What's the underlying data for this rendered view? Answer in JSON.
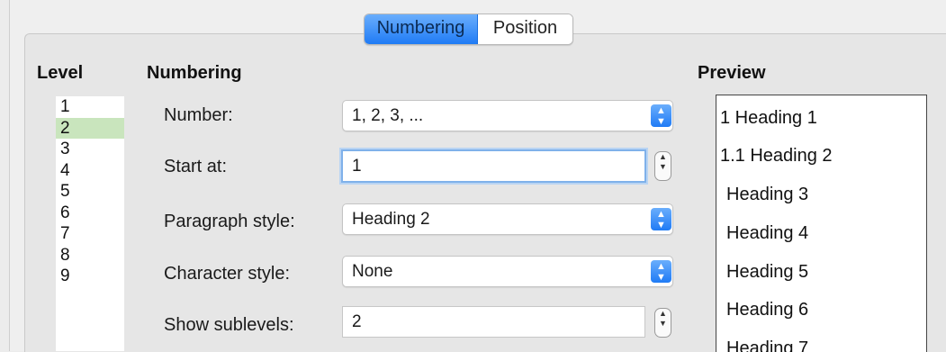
{
  "tabs": [
    {
      "label": "Numbering",
      "active": true
    },
    {
      "label": "Position",
      "active": false
    }
  ],
  "level": {
    "heading": "Level",
    "items": [
      "1",
      "2",
      "3",
      "4",
      "5",
      "6",
      "7",
      "8",
      "9"
    ],
    "selected": "2"
  },
  "numbering": {
    "heading": "Numbering",
    "number_label": "Number:",
    "number_value": "1, 2, 3, ...",
    "start_label": "Start at:",
    "start_value": "1",
    "paragraph_label": "Paragraph style:",
    "paragraph_value": "Heading 2",
    "character_label": "Character style:",
    "character_value": "None",
    "sublevels_label": "Show sublevels:",
    "sublevels_value": "2"
  },
  "preview": {
    "heading": "Preview",
    "lines": [
      "1 Heading 1",
      "1.1 Heading 2",
      "Heading 3",
      "Heading 4",
      "Heading 5",
      "Heading 6",
      "Heading 7"
    ]
  },
  "colors": {
    "accent": "#1f7bf5",
    "selected_row": "#c9e5bd"
  }
}
